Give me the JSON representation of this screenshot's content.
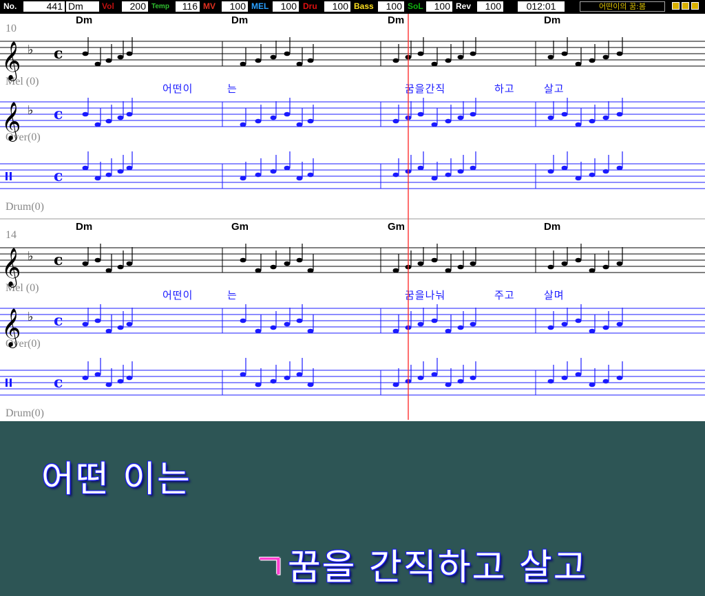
{
  "toolbar": {
    "no_label": "No.",
    "no_value": "441",
    "key_value": "Dm",
    "vol_label": "Vol",
    "vol_value": "200",
    "temp_label": "Temp",
    "temp_value": "116",
    "mv_label": "MV",
    "mv_value": "100",
    "mel_label": "MEL",
    "mel_value": "100",
    "dru_label": "Dru",
    "dru_value": "100",
    "bass_label": "Bass",
    "bass_value": "100",
    "sol_label": "SoL",
    "sol_value": "100",
    "rev_label": "Rev",
    "rev_value": "100",
    "time": "012:01",
    "song_title": "어떤이의 꿈:봄",
    "colors": {
      "no": "#ffffff",
      "vol": "#c01010",
      "temp": "#30c030",
      "mv": "#e03020",
      "mel": "#2aa0ff",
      "dru": "#e01010",
      "bass": "#ffe020",
      "sol": "#10b010",
      "rev": "#ffffff"
    }
  },
  "score": {
    "systems": [
      {
        "measure_number": "10",
        "chords": [
          "Dm",
          "Dm",
          "Dm",
          "Dm"
        ],
        "melody_label": "Mel (0)",
        "over_label": "Over(0)",
        "drum_label": "Drum(0)",
        "lyrics": [
          "어떤이",
          "는",
          "꿈을간직",
          "하고",
          "살고"
        ]
      },
      {
        "measure_number": "14",
        "chords": [
          "Dm",
          "Gm",
          "Gm",
          "Dm"
        ],
        "melody_label": "Mel (0)",
        "over_label": "Over(0)",
        "drum_label": "Drum(0)",
        "lyrics": [
          "어떤이",
          "는",
          "꿈을나눠",
          "주고",
          "살며"
        ]
      }
    ],
    "ink_color": "#1a1aff"
  },
  "lyrics_panel": {
    "line1": "어떤 이는",
    "line2_sung": "ㄱ",
    "line2_rest": "꿈을 간직하고 살고"
  }
}
